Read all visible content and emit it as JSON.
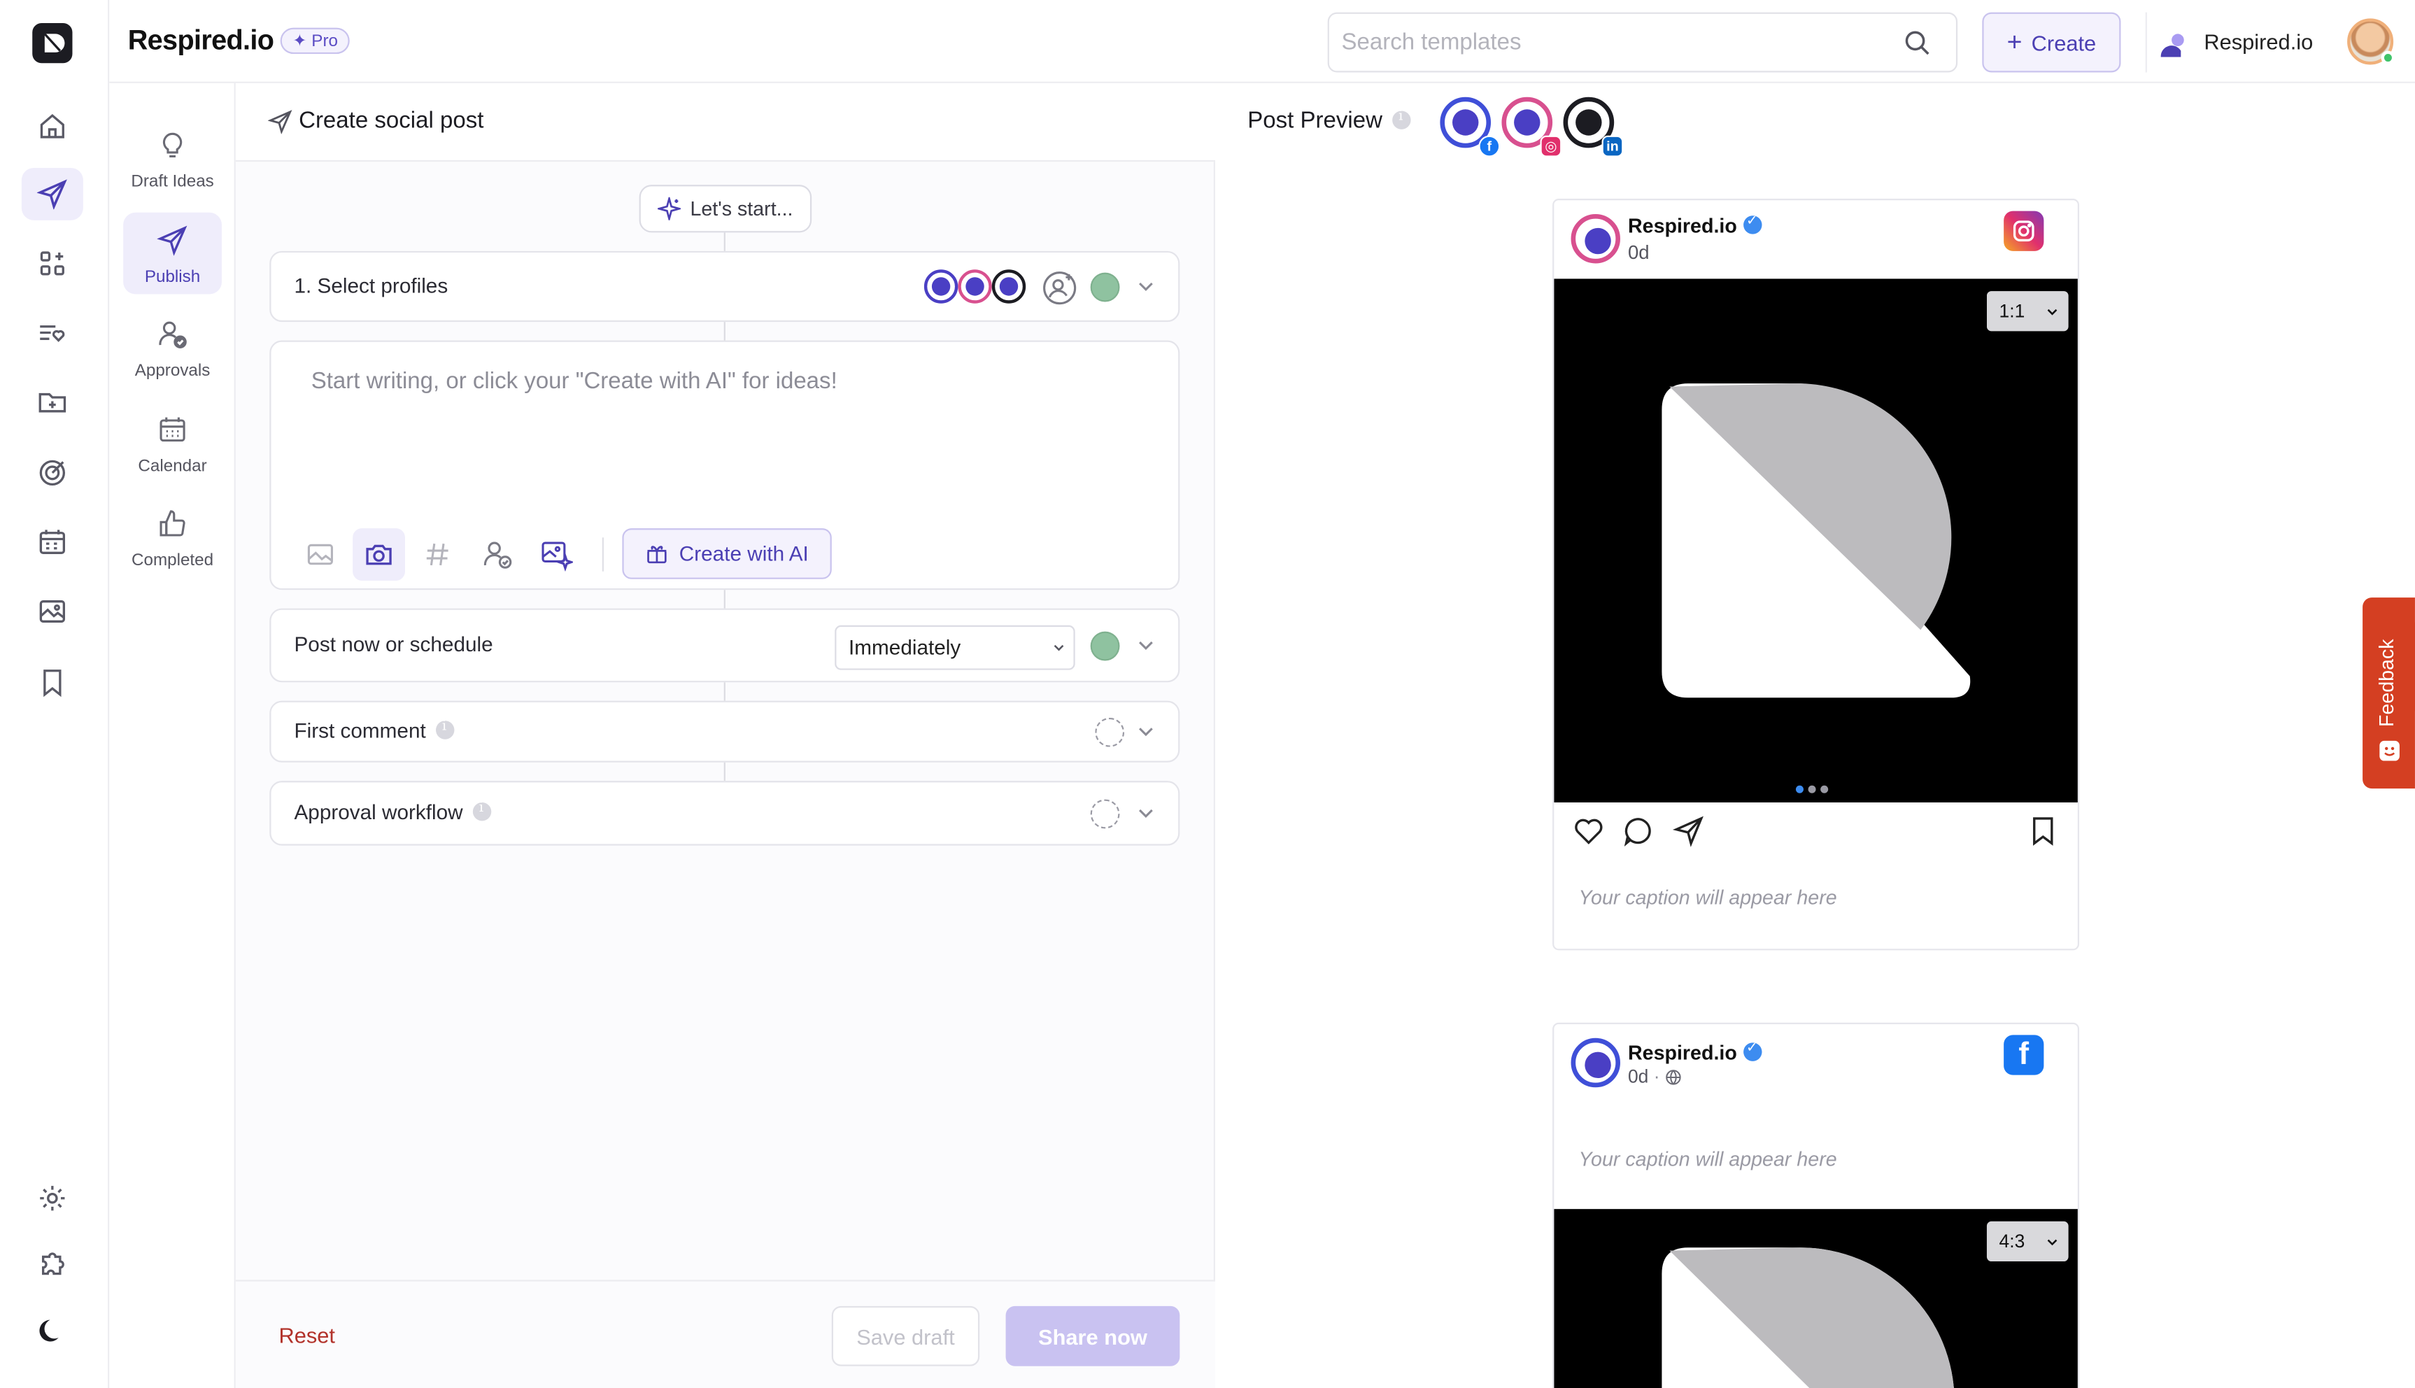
{
  "app": {
    "brand": "Respired.io",
    "badge": "✦ Pro"
  },
  "search": {
    "placeholder": "Search templates"
  },
  "topbar": {
    "create_label": "Create",
    "account_name": "Respired.io"
  },
  "rail": {
    "items": [
      "logo",
      "home",
      "publish",
      "apps",
      "lists",
      "folder-add",
      "target",
      "calendar",
      "media",
      "bookmark"
    ],
    "bottom": [
      "settings",
      "integrations",
      "dark-mode"
    ]
  },
  "subnav": {
    "items": [
      {
        "label": "Draft Ideas",
        "icon": "bulb-icon"
      },
      {
        "label": "Publish",
        "icon": "send-icon",
        "active": true
      },
      {
        "label": "Approvals",
        "icon": "user-check-icon"
      },
      {
        "label": "Calendar",
        "icon": "calendar-icon"
      },
      {
        "label": "Completed",
        "icon": "thumbs-up-icon"
      }
    ]
  },
  "composer": {
    "title": "Create social post",
    "lets_start": "Let's start...",
    "select_profiles_label": "1. Select profiles",
    "editor_placeholder": "Start writing, or click your \"Create with AI\" for ideas!",
    "create_ai_label": "Create with AI",
    "schedule_label": "Post now or schedule",
    "schedule_value": "Immediately",
    "first_comment_label": "First comment",
    "approval_label": "Approval workflow",
    "reset_label": "Reset",
    "save_draft_label": "Save draft",
    "share_now_label": "Share now"
  },
  "preview": {
    "title": "Post Preview",
    "networks": [
      {
        "name": "facebook",
        "color": "#3f4fd8"
      },
      {
        "name": "instagram",
        "color": "#d8508f"
      },
      {
        "name": "linkedin",
        "color": "#1c1c22"
      }
    ],
    "instagram_post": {
      "name": "Respired.io",
      "time": "0d",
      "ratio": "1:1",
      "caption": "Your caption will appear here"
    },
    "facebook_post": {
      "name": "Respired.io",
      "time": "0d",
      "ratio": "4:3",
      "caption": "Your caption will appear here"
    }
  },
  "feedback": {
    "label": "Feedback"
  },
  "colors": {
    "accent": "#4b3fb3",
    "accent_soft": "#efedfb",
    "feedback": "#d43f22",
    "share_disabled": "#c9c2f1"
  }
}
